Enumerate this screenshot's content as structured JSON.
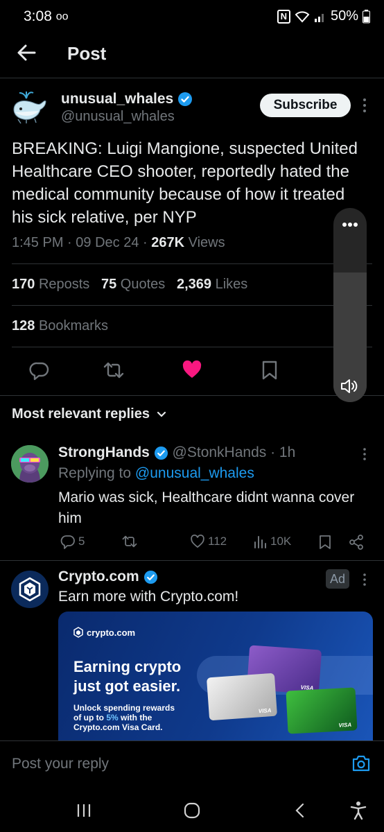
{
  "status_bar": {
    "time": "3:08",
    "battery": "50%"
  },
  "header": {
    "title": "Post"
  },
  "post": {
    "author_name": "unusual_whales",
    "author_handle": "@unusual_whales",
    "subscribe_label": "Subscribe",
    "text": "BREAKING: Luigi Mangione, suspected United Healthcare CEO shooter, reportedly hated the medical community because of how it treated his sick relative, per NYP",
    "time": "1:45 PM",
    "date": "09 Dec 24",
    "views_count": "267K",
    "views_label": "Views",
    "reposts_count": "170",
    "reposts_label": "Reposts",
    "quotes_count": "75",
    "quotes_label": "Quotes",
    "likes_count": "2,369",
    "likes_label": "Likes",
    "bookmarks_count": "128",
    "bookmarks_label": "Bookmarks"
  },
  "replies_section": {
    "label": "Most relevant replies"
  },
  "reply": {
    "author_name": "StrongHands",
    "author_handle": "@StonkHands",
    "age": "· 1h",
    "replying_to_label": "Replying to",
    "replying_to_handle": "@unusual_whales",
    "text": "Mario was sick, Healthcare didnt wanna cover him",
    "comments": "5",
    "likes": "112",
    "views": "10K"
  },
  "ad": {
    "author_name": "Crypto.com",
    "badge": "Ad",
    "text": "Earn more with Crypto.com!",
    "card_brand": "crypto.com",
    "card_headline_1": "Earning crypto",
    "card_headline_2": "just got easier.",
    "card_sub_1": "Unlock spending rewards",
    "card_sub_2_pre": "of up to ",
    "card_sub_2_pct": "5%",
    "card_sub_2_post": " with the",
    "card_sub_3": "Crypto.com Visa Card.",
    "card_visa": "VISA"
  },
  "composer": {
    "placeholder": "Post your reply"
  },
  "colors": {
    "accent": "#1d9bf0",
    "like": "#f91880",
    "background": "#000000"
  }
}
